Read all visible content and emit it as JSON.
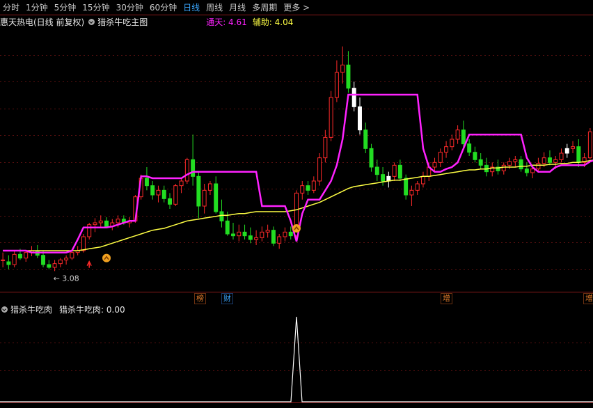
{
  "tabs": [
    {
      "label": "分时",
      "active": false
    },
    {
      "label": "1分钟",
      "active": false
    },
    {
      "label": "5分钟",
      "active": false
    },
    {
      "label": "15分钟",
      "active": false
    },
    {
      "label": "30分钟",
      "active": false
    },
    {
      "label": "60分钟",
      "active": false
    },
    {
      "label": "日线",
      "active": true
    },
    {
      "label": "周线",
      "active": false
    },
    {
      "label": "月线",
      "active": false
    },
    {
      "label": "多周期",
      "active": false
    },
    {
      "label": "更多 >",
      "active": false
    }
  ],
  "stock_info": {
    "title": "惠天热电(日线 前复权)",
    "indicator": "猎杀牛吃主图",
    "line1_label": "通天: 4.61",
    "line2_label": "辅助: 4.04"
  },
  "chart_annotations": {
    "low_label": "3.08"
  },
  "event_badges": [
    {
      "text": "榜",
      "color": "#e07b2a"
    },
    {
      "text": "财",
      "color": "#3aa7ff"
    },
    {
      "text": "增",
      "color": "#e07b2a"
    },
    {
      "text": "增",
      "color": "#e07b2a"
    }
  ],
  "sub_panel": {
    "indicator": "猎杀牛吃肉",
    "value_label": "猎杀牛吃肉: 0.00"
  },
  "colors": {
    "up": "#ff2a2a",
    "down": "#22dd22",
    "white": "#ffffff",
    "tongtian": "#ff22ff",
    "fuzhu": "#ffff44",
    "grid": "#5a1010"
  },
  "chart_data": {
    "type": "candlestick",
    "ylim": [
      2.85,
      5.7
    ],
    "candles": [
      [
        3.2,
        3.28,
        3.12,
        3.2
      ],
      [
        3.18,
        3.25,
        3.1,
        3.15
      ],
      [
        3.15,
        3.3,
        3.12,
        3.26
      ],
      [
        3.26,
        3.32,
        3.2,
        3.22
      ],
      [
        3.22,
        3.3,
        3.18,
        3.28
      ],
      [
        3.28,
        3.35,
        3.24,
        3.3
      ],
      [
        3.3,
        3.36,
        3.22,
        3.25
      ],
      [
        3.25,
        3.3,
        3.12,
        3.15
      ],
      [
        3.15,
        3.2,
        3.1,
        3.12
      ],
      [
        3.12,
        3.2,
        3.08,
        3.16
      ],
      [
        3.16,
        3.22,
        3.12,
        3.2
      ],
      [
        3.2,
        3.25,
        3.15,
        3.22
      ],
      [
        3.22,
        3.3,
        3.2,
        3.28
      ],
      [
        3.28,
        3.35,
        3.25,
        3.3
      ],
      [
        3.3,
        3.48,
        3.28,
        3.45
      ],
      [
        3.45,
        3.6,
        3.42,
        3.58
      ],
      [
        3.58,
        3.65,
        3.5,
        3.6
      ],
      [
        3.6,
        3.68,
        3.55,
        3.62
      ],
      [
        3.62,
        3.66,
        3.54,
        3.56
      ],
      [
        3.56,
        3.64,
        3.52,
        3.6
      ],
      [
        3.6,
        3.68,
        3.55,
        3.64
      ],
      [
        3.64,
        3.68,
        3.58,
        3.6
      ],
      [
        3.6,
        3.66,
        3.55,
        3.62
      ],
      [
        3.62,
        3.9,
        3.6,
        3.88
      ],
      [
        3.88,
        4.12,
        3.85,
        4.08
      ],
      [
        4.08,
        4.2,
        3.95,
        4.0
      ],
      [
        4.0,
        4.05,
        3.85,
        3.9
      ],
      [
        3.9,
        4.0,
        3.82,
        3.95
      ],
      [
        3.95,
        4.0,
        3.82,
        3.86
      ],
      [
        3.86,
        3.92,
        3.75,
        3.8
      ],
      [
        3.8,
        4.02,
        3.78,
        4.0
      ],
      [
        4.0,
        4.08,
        3.92,
        4.05
      ],
      [
        4.05,
        4.3,
        4.02,
        4.28
      ],
      [
        4.28,
        4.55,
        4.0,
        4.1
      ],
      [
        4.1,
        4.15,
        3.65,
        3.78
      ],
      [
        3.78,
        4.02,
        3.7,
        3.95
      ],
      [
        3.95,
        4.05,
        3.9,
        4.02
      ],
      [
        4.02,
        4.1,
        3.7,
        3.72
      ],
      [
        3.72,
        3.85,
        3.55,
        3.62
      ],
      [
        3.62,
        3.72,
        3.46,
        3.48
      ],
      [
        3.48,
        3.6,
        3.42,
        3.46
      ],
      [
        3.46,
        3.58,
        3.4,
        3.5
      ],
      [
        3.5,
        3.58,
        3.42,
        3.46
      ],
      [
        3.46,
        3.55,
        3.38,
        3.42
      ],
      [
        3.42,
        3.52,
        3.36,
        3.44
      ],
      [
        3.44,
        3.56,
        3.4,
        3.5
      ],
      [
        3.5,
        3.58,
        3.44,
        3.52
      ],
      [
        3.52,
        3.56,
        3.35,
        3.38
      ],
      [
        3.38,
        3.48,
        3.32,
        3.45
      ],
      [
        3.45,
        3.55,
        3.4,
        3.5
      ],
      [
        3.5,
        3.56,
        3.42,
        3.46
      ],
      [
        3.46,
        3.95,
        3.44,
        3.92
      ],
      [
        3.92,
        4.05,
        3.85,
        4.0
      ],
      [
        4.0,
        4.05,
        3.9,
        3.95
      ],
      [
        3.95,
        4.1,
        3.92,
        4.05
      ],
      [
        4.05,
        4.35,
        4.0,
        4.3
      ],
      [
        4.3,
        4.6,
        4.25,
        4.52
      ],
      [
        4.52,
        5.02,
        4.48,
        4.95
      ],
      [
        4.95,
        5.35,
        4.9,
        5.22
      ],
      [
        5.22,
        5.5,
        5.1,
        5.3
      ],
      [
        5.3,
        5.45,
        5.0,
        5.05
      ],
      [
        5.05,
        5.12,
        4.8,
        4.85
      ],
      [
        4.85,
        4.95,
        4.55,
        4.6
      ],
      [
        4.6,
        4.68,
        4.35,
        4.4
      ],
      [
        4.4,
        4.45,
        4.15,
        4.2
      ],
      [
        4.2,
        4.28,
        4.05,
        4.12
      ],
      [
        4.12,
        4.2,
        4.0,
        4.05
      ],
      [
        4.05,
        4.15,
        3.98,
        4.1
      ],
      [
        4.1,
        4.25,
        4.05,
        4.22
      ],
      [
        4.22,
        4.28,
        4.05,
        4.08
      ],
      [
        4.08,
        4.12,
        3.85,
        3.9
      ],
      [
        3.9,
        4.0,
        3.78,
        3.95
      ],
      [
        3.95,
        4.05,
        3.9,
        4.02
      ],
      [
        4.02,
        4.15,
        3.98,
        4.1
      ],
      [
        4.1,
        4.25,
        4.05,
        4.2
      ],
      [
        4.2,
        4.3,
        4.15,
        4.25
      ],
      [
        4.25,
        4.4,
        4.2,
        4.36
      ],
      [
        4.36,
        4.48,
        4.3,
        4.42
      ],
      [
        4.42,
        4.55,
        4.38,
        4.5
      ],
      [
        4.5,
        4.65,
        4.45,
        4.6
      ],
      [
        4.6,
        4.7,
        4.4,
        4.45
      ],
      [
        4.45,
        4.5,
        4.32,
        4.36
      ],
      [
        4.36,
        4.42,
        4.25,
        4.28
      ],
      [
        4.28,
        4.35,
        4.18,
        4.22
      ],
      [
        4.22,
        4.3,
        4.1,
        4.15
      ],
      [
        4.15,
        4.25,
        4.1,
        4.2
      ],
      [
        4.2,
        4.28,
        4.12,
        4.16
      ],
      [
        4.16,
        4.25,
        4.12,
        4.22
      ],
      [
        4.22,
        4.3,
        4.18,
        4.26
      ],
      [
        4.26,
        4.32,
        4.2,
        4.28
      ],
      [
        4.28,
        4.32,
        4.15,
        4.18
      ],
      [
        4.18,
        4.25,
        4.1,
        4.14
      ],
      [
        4.14,
        4.2,
        4.08,
        4.18
      ],
      [
        4.18,
        4.3,
        4.15,
        4.24
      ],
      [
        4.24,
        4.36,
        4.2,
        4.3
      ],
      [
        4.3,
        4.38,
        4.22,
        4.25
      ],
      [
        4.25,
        4.32,
        4.18,
        4.28
      ],
      [
        4.28,
        4.4,
        4.25,
        4.35
      ],
      [
        4.35,
        4.45,
        4.3,
        4.4
      ],
      [
        4.4,
        4.48,
        4.35,
        4.42
      ],
      [
        4.42,
        4.5,
        4.2,
        4.25
      ],
      [
        4.25,
        4.35,
        4.2,
        4.3
      ],
      [
        4.3,
        4.62,
        4.28,
        4.58
      ]
    ],
    "tongtian": [
      3.3,
      3.3,
      3.3,
      3.3,
      3.3,
      3.28,
      3.28,
      3.28,
      3.28,
      3.28,
      3.28,
      3.28,
      3.3,
      3.42,
      3.55,
      3.55,
      3.55,
      3.55,
      3.55,
      3.56,
      3.58,
      3.6,
      3.62,
      3.62,
      4.1,
      4.1,
      4.08,
      4.08,
      4.08,
      4.08,
      4.08,
      4.08,
      4.12,
      4.15,
      4.15,
      4.15,
      4.15,
      4.15,
      4.15,
      4.15,
      4.15,
      4.15,
      4.15,
      4.15,
      4.15,
      3.78,
      3.78,
      3.78,
      3.78,
      3.78,
      3.62,
      3.4,
      3.7,
      3.85,
      3.85,
      3.85,
      3.95,
      4.05,
      4.22,
      4.5,
      4.98,
      4.98,
      4.98,
      4.98,
      4.98,
      4.98,
      4.98,
      4.98,
      4.98,
      4.98,
      4.98,
      4.98,
      4.98,
      4.4,
      4.2,
      4.15,
      4.15,
      4.18,
      4.2,
      4.25,
      4.4,
      4.55,
      4.55,
      4.55,
      4.55,
      4.55,
      4.55,
      4.55,
      4.55,
      4.55,
      4.55,
      4.3,
      4.2,
      4.15,
      4.15,
      4.15,
      4.2,
      4.22,
      4.22,
      4.22,
      4.22,
      4.22,
      4.26,
      4.28,
      4.32
    ],
    "fuzhu": [
      3.3,
      3.3,
      3.3,
      3.3,
      3.3,
      3.3,
      3.3,
      3.3,
      3.3,
      3.3,
      3.3,
      3.3,
      3.3,
      3.3,
      3.31,
      3.32,
      3.33,
      3.34,
      3.36,
      3.38,
      3.4,
      3.42,
      3.44,
      3.46,
      3.48,
      3.5,
      3.52,
      3.53,
      3.54,
      3.56,
      3.58,
      3.6,
      3.62,
      3.63,
      3.64,
      3.65,
      3.66,
      3.67,
      3.68,
      3.68,
      3.69,
      3.7,
      3.7,
      3.71,
      3.72,
      3.72,
      3.72,
      3.72,
      3.72,
      3.72,
      3.73,
      3.74,
      3.76,
      3.78,
      3.8,
      3.82,
      3.85,
      3.88,
      3.91,
      3.94,
      3.97,
      3.99,
      4.0,
      4.01,
      4.02,
      4.03,
      4.04,
      4.05,
      4.06,
      4.06,
      4.07,
      4.08,
      4.09,
      4.1,
      4.1,
      4.11,
      4.12,
      4.13,
      4.14,
      4.15,
      4.16,
      4.17,
      4.17,
      4.18,
      4.18,
      4.19,
      4.19,
      4.2,
      4.2,
      4.2,
      4.21,
      4.21,
      4.22,
      4.22,
      4.22,
      4.23,
      4.23,
      4.24,
      4.24,
      4.25,
      4.25,
      4.26,
      4.27,
      4.28,
      4.28
    ],
    "sub_values_spike_index": 51
  }
}
